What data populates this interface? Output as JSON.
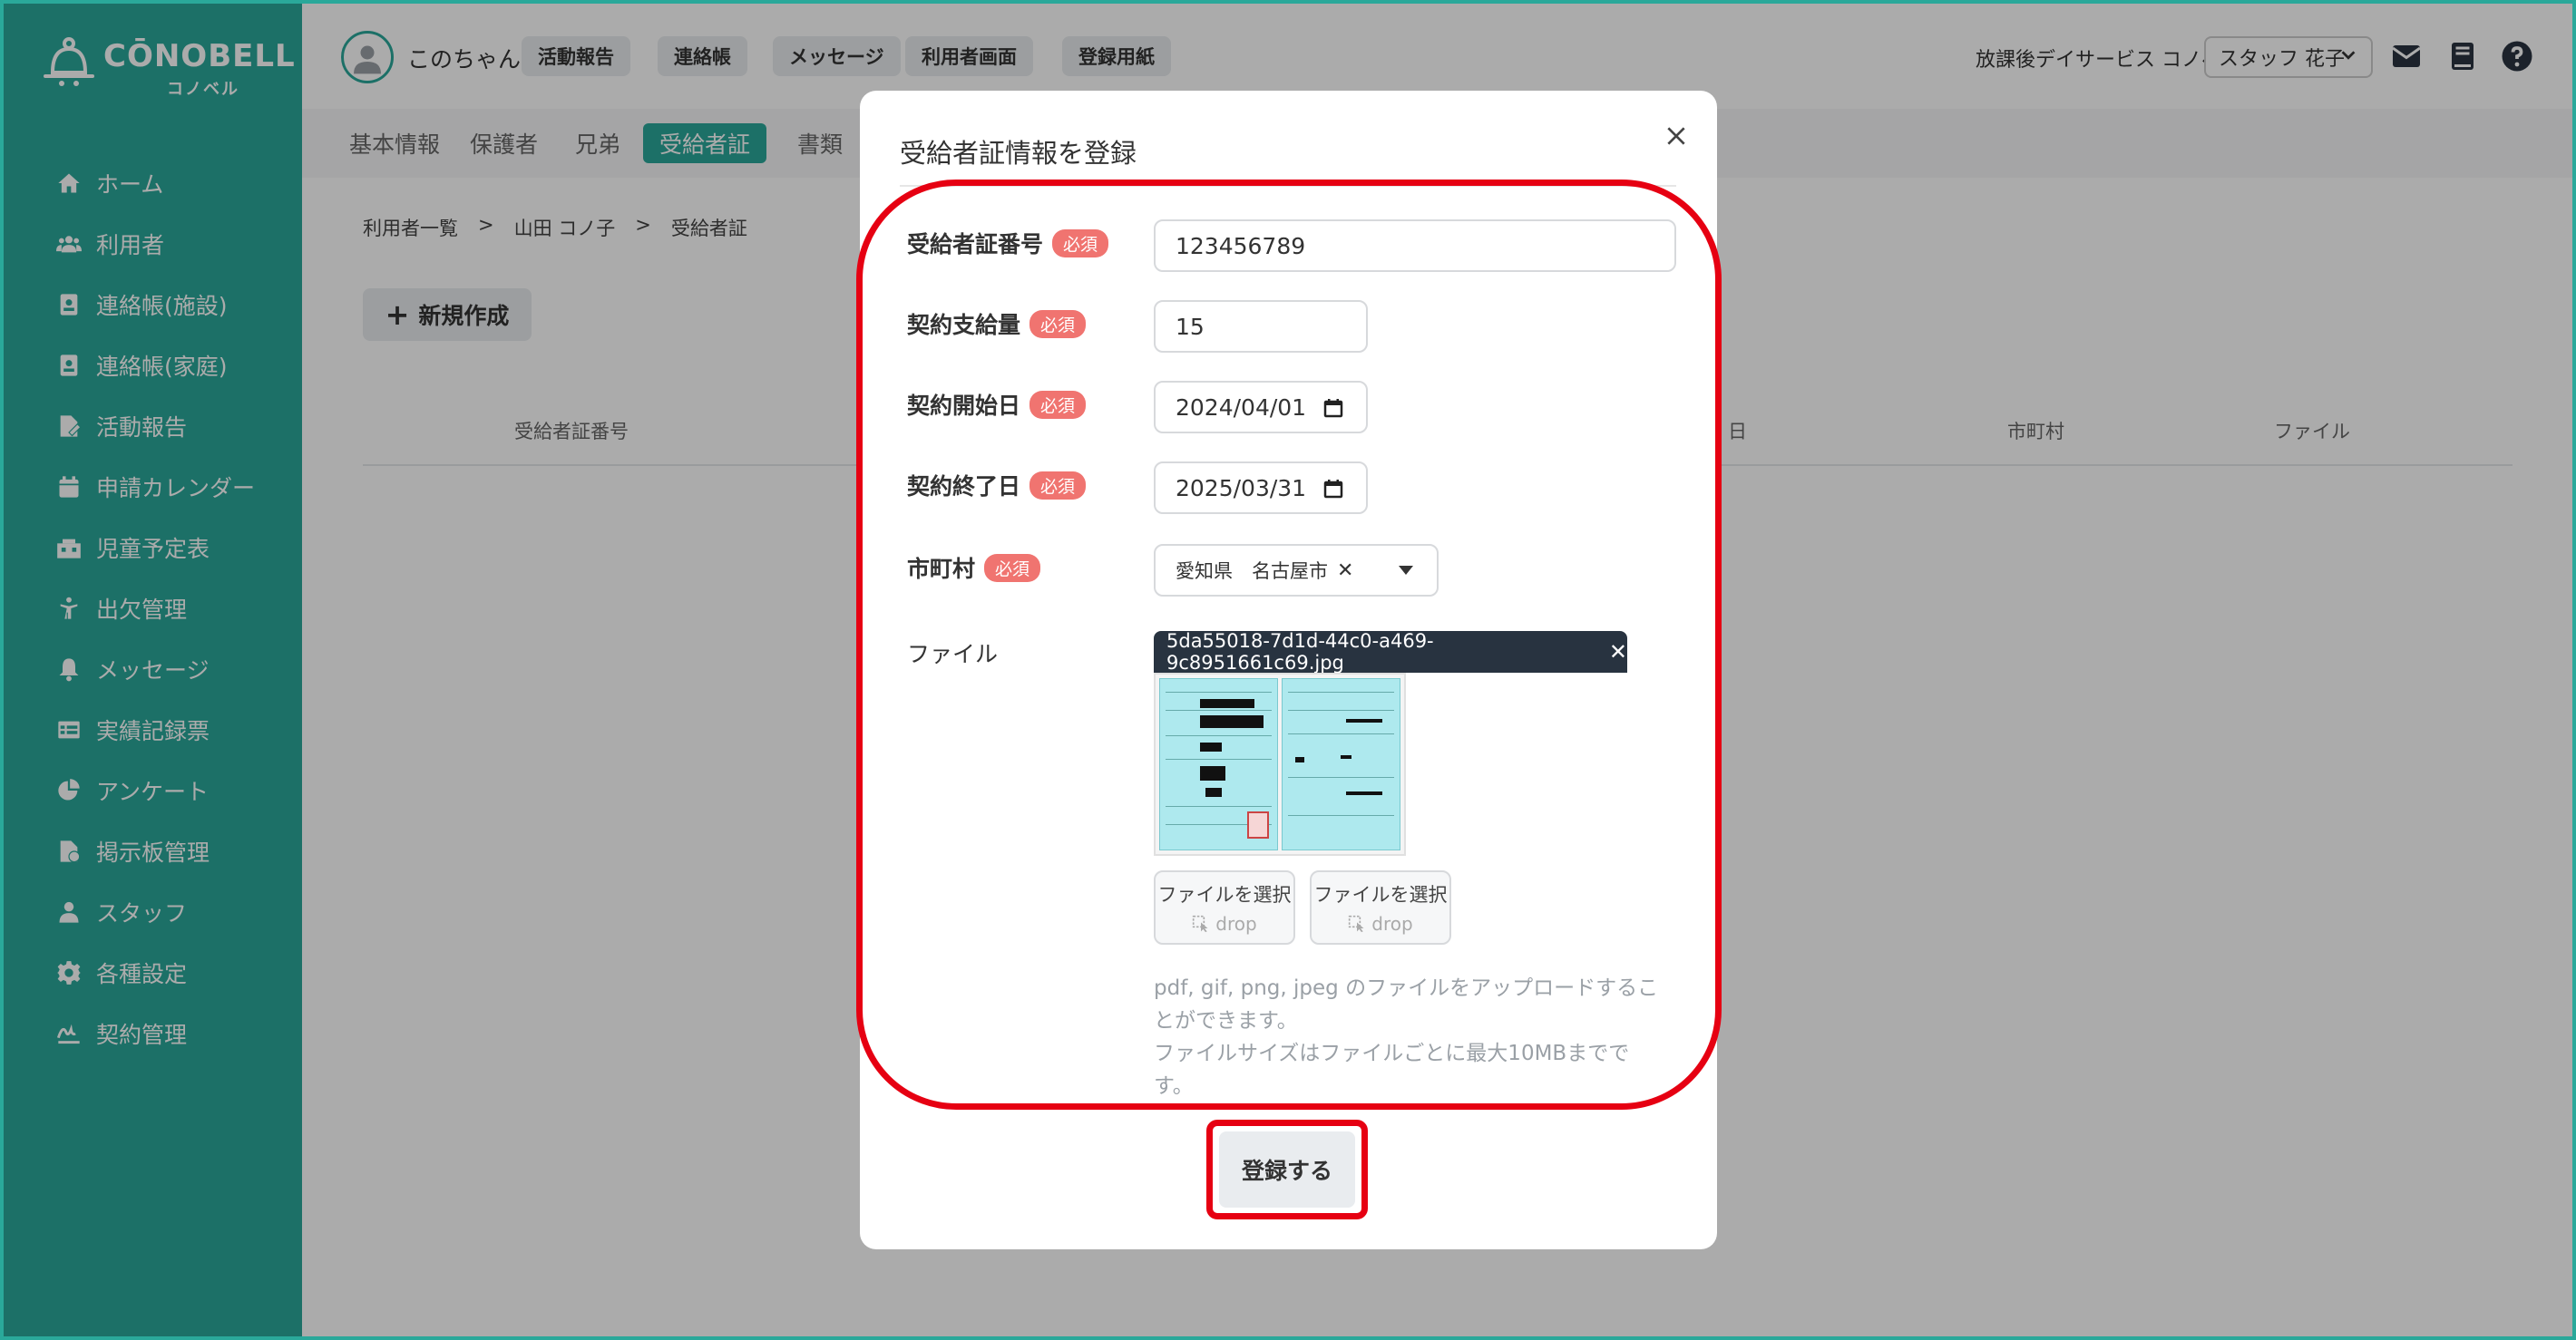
{
  "app": {
    "logo_text": "CŌNOBELL",
    "logo_sub": "コノベル",
    "brand_color": "#2aa89a"
  },
  "sidebar": {
    "items": [
      {
        "label": "ホーム",
        "icon": "home-icon"
      },
      {
        "label": "利用者",
        "icon": "users-icon"
      },
      {
        "label": "連絡帳(施設)",
        "icon": "contact-book-icon"
      },
      {
        "label": "連絡帳(家庭)",
        "icon": "contact-book-icon"
      },
      {
        "label": "活動報告",
        "icon": "report-icon"
      },
      {
        "label": "申請カレンダー",
        "icon": "calendar-icon"
      },
      {
        "label": "児童予定表",
        "icon": "schedule-icon"
      },
      {
        "label": "出欠管理",
        "icon": "attendance-icon"
      },
      {
        "label": "メッセージ",
        "icon": "bell-icon"
      },
      {
        "label": "実績記録票",
        "icon": "table-icon"
      },
      {
        "label": "アンケート",
        "icon": "pie-chart-icon"
      },
      {
        "label": "掲示板管理",
        "icon": "board-icon"
      },
      {
        "label": "スタッフ",
        "icon": "staff-icon"
      },
      {
        "label": "各種設定",
        "icon": "gear-icon"
      },
      {
        "label": "契約管理",
        "icon": "signature-icon"
      }
    ]
  },
  "header": {
    "user_name": "このちゃん",
    "buttons": [
      "活動報告",
      "連絡帳",
      "メッセージ",
      "利用者画面",
      "登録用紙"
    ],
    "facility_name": "放課後デイサービス コノベル",
    "staff_select": "スタッフ 花子"
  },
  "main": {
    "tabs": [
      "基本情報",
      "保護者",
      "兄弟",
      "受給者証",
      "書類"
    ],
    "active_tab": "受給者証",
    "breadcrumb": [
      "利用者一覧",
      ">",
      "山田 コノ子",
      ">",
      "受給者証"
    ],
    "new_button": "新規作成",
    "columns": [
      "受給者証番号",
      "日",
      "市町村",
      "ファイル"
    ]
  },
  "modal": {
    "title": "受給者証情報を登録",
    "required_badge": "必須",
    "fields": {
      "cert_number": {
        "label": "受給者証番号",
        "value": "123456789"
      },
      "supply_amount": {
        "label": "契約支給量",
        "value": "15"
      },
      "start_date": {
        "label": "契約開始日",
        "value": "2024/04/01"
      },
      "end_date": {
        "label": "契約終了日",
        "value": "2025/03/31"
      },
      "city": {
        "label": "市町村",
        "value": "愛知県　名古屋市"
      },
      "file": {
        "label": "ファイル",
        "file_name": "5da55018-7d1d-44c0-a469-9c8951661c69.jpg"
      }
    },
    "file_pick_label": "ファイルを選択",
    "drop_label": "drop",
    "hint_line1": "pdf, gif, png, jpeg のファイルをアップロードすることができます。",
    "hint_line2": "ファイルサイズはファイルごとに最大10MBまでです。",
    "submit_label": "登録する"
  }
}
